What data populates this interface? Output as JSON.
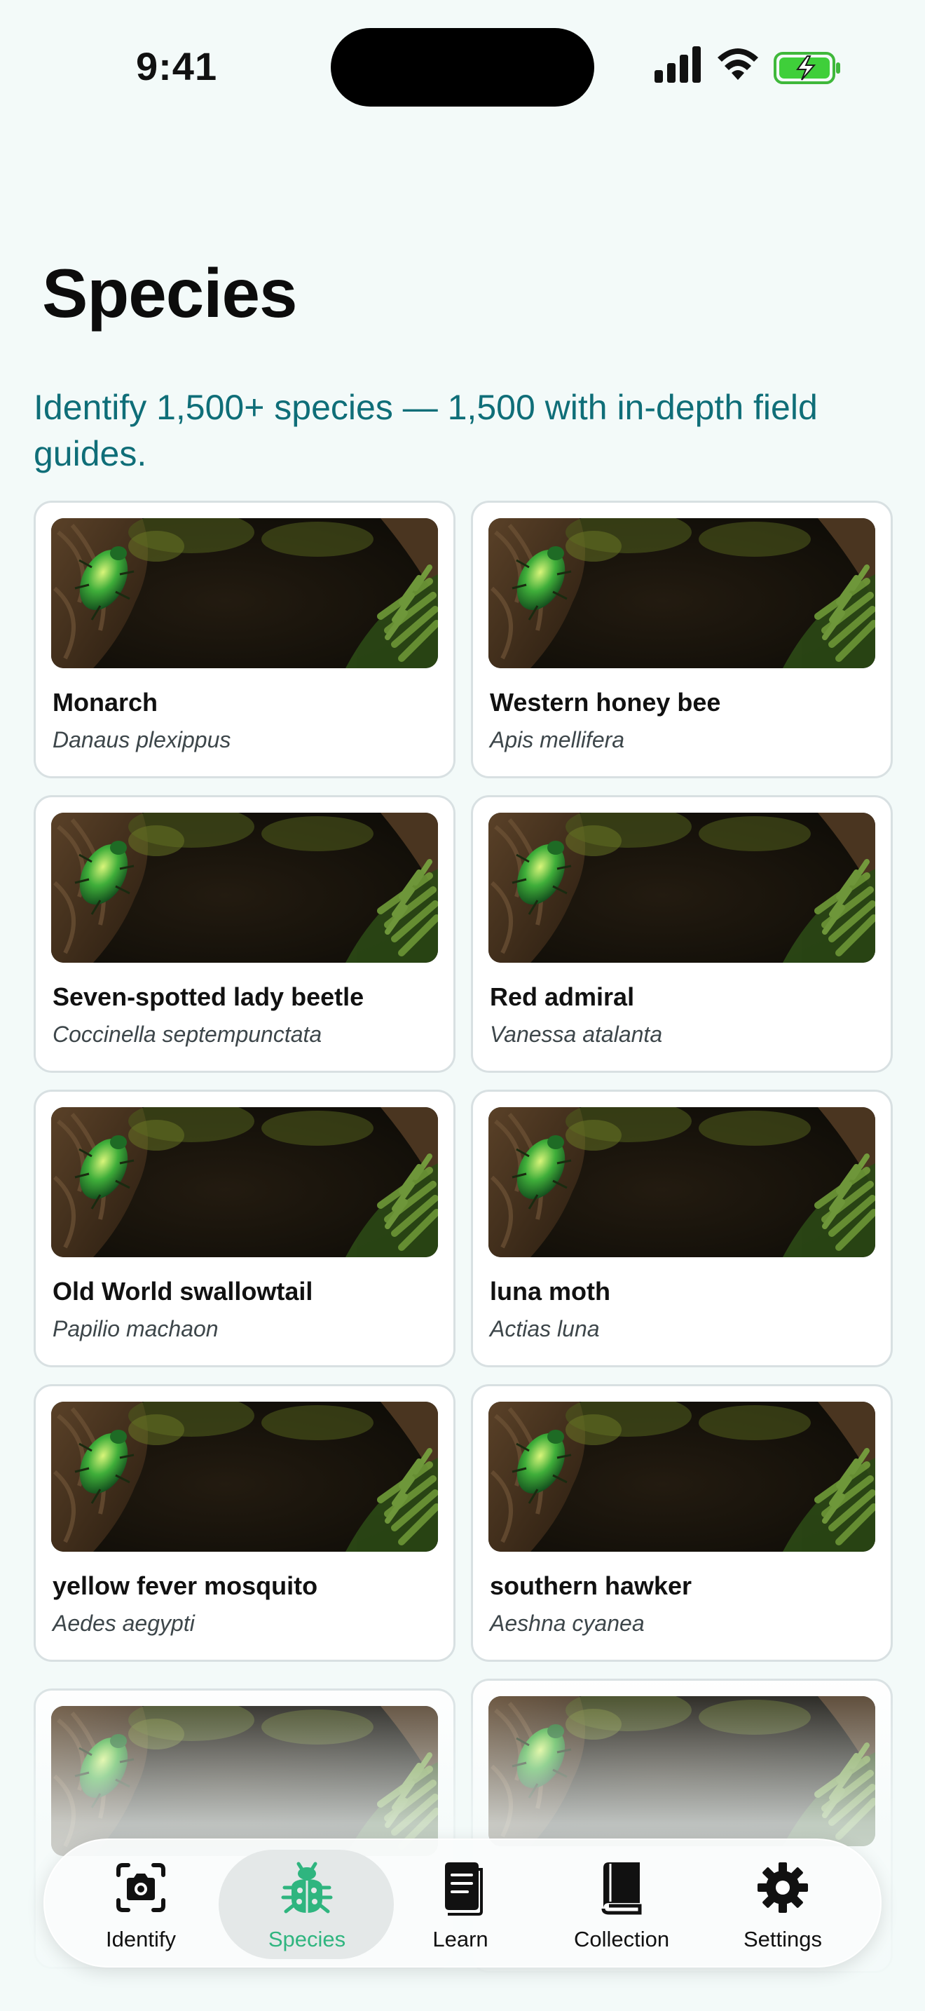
{
  "status_bar": {
    "time": "9:41"
  },
  "header": {
    "title": "Species",
    "subtitle": "Identify 1,500+ species — 1,500 with in-depth field guides."
  },
  "species": [
    {
      "name": "Monarch",
      "scientific": "Danaus plexippus"
    },
    {
      "name": "Western honey bee",
      "scientific": "Apis mellifera"
    },
    {
      "name": "Seven-spotted lady beetle",
      "scientific": "Coccinella septempunctata"
    },
    {
      "name": "Red admiral",
      "scientific": "Vanessa atalanta"
    },
    {
      "name": "Old World swallowtail",
      "scientific": "Papilio machaon"
    },
    {
      "name": "luna moth",
      "scientific": "Actias luna"
    },
    {
      "name": "yellow fever mosquito",
      "scientific": "Aedes aegypti"
    },
    {
      "name": "southern hawker",
      "scientific": "Aeshna cyanea"
    },
    {
      "name": "",
      "scientific": ""
    },
    {
      "name": "",
      "scientific": ""
    }
  ],
  "tab_bar": {
    "tabs": [
      {
        "label": "Identify",
        "icon": "camera-icon"
      },
      {
        "label": "Species",
        "icon": "ladybug-icon",
        "active": true
      },
      {
        "label": "Learn",
        "icon": "notebook-icon"
      },
      {
        "label": "Collection",
        "icon": "book-icon"
      },
      {
        "label": "Settings",
        "icon": "gear-icon"
      }
    ]
  },
  "colors": {
    "accent": "#2fb57f",
    "subtitle": "#0f6e78",
    "background": "#f3faf9"
  }
}
